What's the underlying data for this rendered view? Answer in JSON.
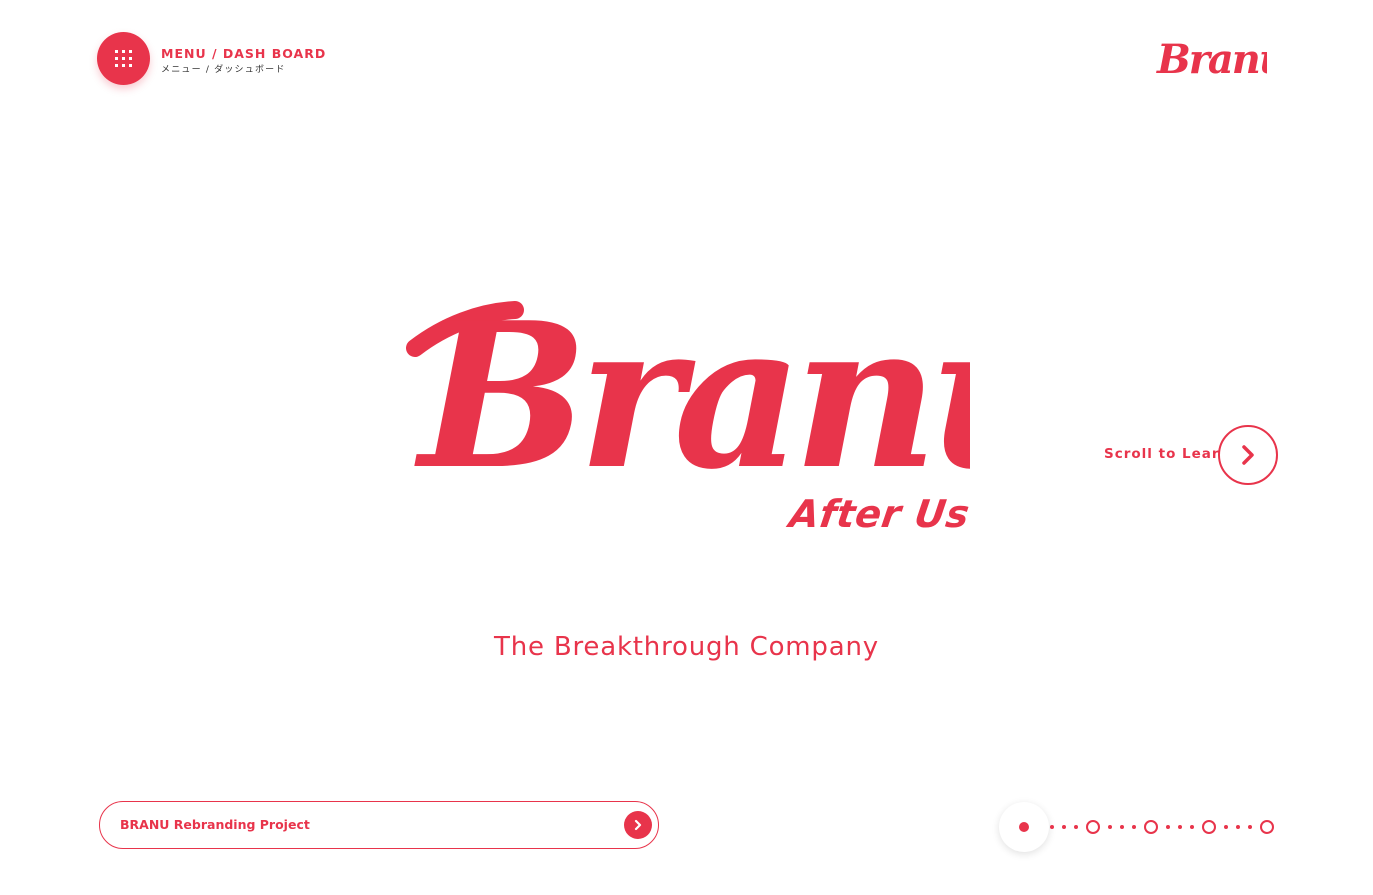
{
  "header": {
    "menu_label_en": "MENU / DASH BOARD",
    "menu_label_jp": "メニュー / ダッシュボード",
    "logo_text": "Branu"
  },
  "hero": {
    "logo_text": "Branu",
    "subtitle": "After Us",
    "tagline": "The Breakthrough Company"
  },
  "scroll": {
    "label": "Scroll to Learn"
  },
  "project": {
    "label": "BRANU Rebranding Project"
  },
  "pagination": {
    "total_pages": 5,
    "active_page": 1
  },
  "colors": {
    "accent": "#e8344b",
    "background": "#ffffff",
    "text_dark": "#333333"
  },
  "icons": {
    "menu": "grid-icon",
    "scroll": "chevron-right-icon",
    "project": "chevron-right-icon"
  }
}
